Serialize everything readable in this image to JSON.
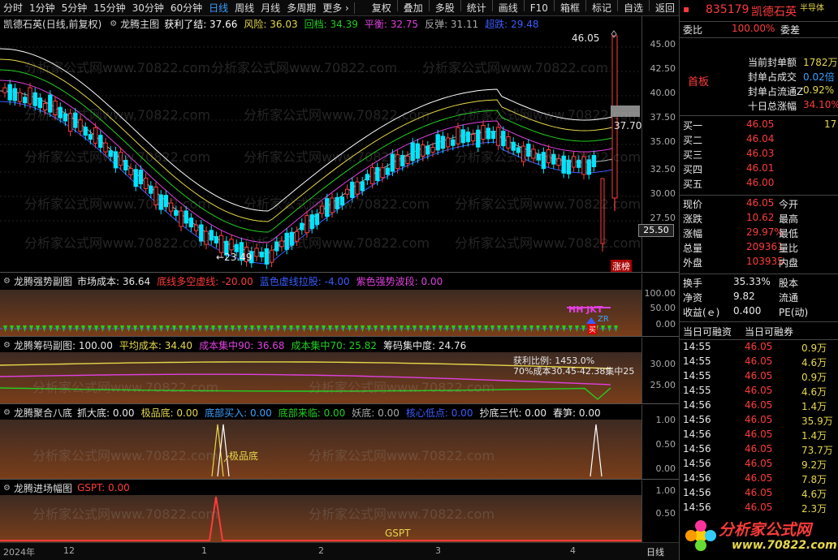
{
  "toolbar": {
    "periods": [
      "分时",
      "1分钟",
      "5分钟",
      "15分钟",
      "30分钟",
      "60分钟",
      "日线",
      "周线",
      "月线",
      "多周期",
      "更多 ›"
    ],
    "active_period": "日线",
    "actions": [
      "复权",
      "叠加",
      "多股",
      "统计",
      "画线",
      "F10",
      "箱框",
      "标记",
      "自选",
      "返回"
    ]
  },
  "main_panel": {
    "stock": "凯德石英",
    "mode": "(日线,前复权)",
    "indicator": "龙腾主图",
    "legend": [
      {
        "label": "获利了结: 37.66",
        "color": "#ffffff"
      },
      {
        "label": "风险: 36.03",
        "color": "#e6d84a"
      },
      {
        "label": "回档: 34.39",
        "color": "#21d021"
      },
      {
        "label": "平衡: 32.75",
        "color": "#e040e0"
      },
      {
        "label": "反弹: 31.11",
        "color": "#aaaaaa"
      },
      {
        "label": "超跌: 29.48",
        "color": "#3a5cff"
      }
    ],
    "high_label": "46.05",
    "low_label": "←23.49",
    "last_price_label": "37.70",
    "cursor_price": "25.50",
    "tag": "涨榜",
    "yaxis": [
      "45.00",
      "42.50",
      "40.00",
      "37.50",
      "35.00",
      "32.50",
      "30.00",
      "27.50"
    ]
  },
  "panel2": {
    "name": "龙腾强势副图",
    "legend": [
      {
        "label": "市场成本: 36.64",
        "color": "#e8e8e8"
      },
      {
        "label": "底线多空虚线: -20.00",
        "color": "#ff3b3b"
      },
      {
        "label": "蓝色虚线拉股: -4.00",
        "color": "#3a5cff"
      },
      {
        "label": "紫色强势波段: 0.00",
        "color": "#e040e0"
      }
    ],
    "marks": [
      "HH JKT",
      "ZR",
      "买"
    ],
    "yaxis": [
      "100.00",
      "50.00",
      "0.00"
    ]
  },
  "panel3": {
    "name": "龙腾筹码副图",
    "legend": [
      {
        "label": ": 100.00",
        "color": "#e8e8e8"
      },
      {
        "label": "平均成本: 34.40",
        "color": "#e6d84a"
      },
      {
        "label": "成本集中90: 36.68",
        "color": "#e040e0"
      },
      {
        "label": "成本集中70: 25.82",
        "color": "#21d021"
      },
      {
        "label": "筹码集中度: 24.76",
        "color": "#e8e8e8"
      }
    ],
    "overlay1": "获利比例: 1453.0%",
    "overlay2": "70%成本30.45-42.38集中25",
    "yaxis": [
      "30.00",
      "25.00"
    ]
  },
  "panel4": {
    "name": "龙腾聚合八底",
    "legend": [
      {
        "label": "抓大底: 0.00",
        "color": "#e8e8e8"
      },
      {
        "label": "极品底: 0.00",
        "color": "#e6d84a"
      },
      {
        "label": "底部买入: 0.00",
        "color": "#3aa0ff"
      },
      {
        "label": "底部来临: 0.00",
        "color": "#21d021"
      },
      {
        "label": "妖底: 0.00",
        "color": "#aaaaaa"
      },
      {
        "label": "核心低点: 0.00",
        "color": "#3a5cff"
      },
      {
        "label": "抄底三代: 0.00",
        "color": "#e8e8e8"
      },
      {
        "label": "春笋: 0.00",
        "color": "#e8e8e8"
      }
    ],
    "mark": "极品底",
    "yaxis": [
      "1.00",
      "0.50",
      "0.00"
    ]
  },
  "panel5": {
    "name": "龙腾进场幅图",
    "legend": [
      {
        "label": "GSPT: 0.00",
        "color": "#ff3b3b"
      }
    ],
    "mark": "GSPT",
    "yaxis": [
      "1.00",
      "0.50"
    ]
  },
  "timeline": {
    "labels": [
      "2024年",
      "12",
      "1",
      "2",
      "3",
      "4"
    ],
    "period": "日线"
  },
  "quote": {
    "code": "835179",
    "name": "凯德石英",
    "weibi_label": "委比",
    "weibi": "100.00%",
    "weicha_label": "委差",
    "board": "首板",
    "seal": [
      {
        "label": "当前封单额",
        "value": "1782万"
      },
      {
        "label": "封单占成交",
        "value": "0.02倍"
      },
      {
        "label": "封单占流通Z",
        "value": "0.92%"
      },
      {
        "label": "十日总涨幅",
        "value": "34.10%"
      }
    ],
    "top_note": "半导体",
    "bids": [
      {
        "label": "买一",
        "price": "46.05",
        "vol": "17"
      },
      {
        "label": "买二",
        "price": "46.04",
        "vol": ""
      },
      {
        "label": "买三",
        "price": "46.03",
        "vol": ""
      },
      {
        "label": "买四",
        "price": "46.01",
        "vol": ""
      },
      {
        "label": "买五",
        "price": "46.00",
        "vol": ""
      }
    ],
    "stats": [
      {
        "l1": "现价",
        "v1": "46.05",
        "l2": "今开"
      },
      {
        "l1": "涨跌",
        "v1": "10.62",
        "l2": "最高"
      },
      {
        "l1": "涨幅",
        "v1": "29.97%",
        "l2": "最低"
      },
      {
        "l1": "总量",
        "v1": "209361",
        "l2": "量比"
      },
      {
        "l1": "外盘",
        "v1": "103935",
        "l2": "内盘"
      }
    ],
    "stats2": [
      {
        "l1": "换手",
        "v1": "35.33%",
        "l2": "股本"
      },
      {
        "l1": "净资",
        "v1": "9.82",
        "l2": "流通"
      },
      {
        "l1": "收益(ｅ)",
        "v1": "0.400",
        "l2": "PE(动)"
      }
    ],
    "margin_tabs": [
      "当日可融资",
      "当日可融券"
    ],
    "ticks": [
      {
        "t": "14:55",
        "p": "46.05",
        "v": "0.9万"
      },
      {
        "t": "14:55",
        "p": "46.05",
        "v": "4.6万"
      },
      {
        "t": "14:55",
        "p": "46.05",
        "v": "0.9万"
      },
      {
        "t": "14:55",
        "p": "46.05",
        "v": "4.6万"
      },
      {
        "t": "14:56",
        "p": "46.05",
        "v": "1.4万"
      },
      {
        "t": "14:56",
        "p": "46.05",
        "v": "35.9万"
      },
      {
        "t": "14:56",
        "p": "46.05",
        "v": "1.4万"
      },
      {
        "t": "14:56",
        "p": "46.05",
        "v": "73.7万"
      },
      {
        "t": "14:56",
        "p": "46.05",
        "v": "9.2万"
      },
      {
        "t": "14:56",
        "p": "46.05",
        "v": "7.8万"
      },
      {
        "t": "14:56",
        "p": "46.05",
        "v": "4.6万"
      },
      {
        "t": "14:56",
        "p": "46.05",
        "v": "2.3万"
      }
    ],
    "logo_text": "分析家公式网",
    "logo_url": "www.70822.com"
  },
  "watermark": "分析家公式网www.70822.com"
}
